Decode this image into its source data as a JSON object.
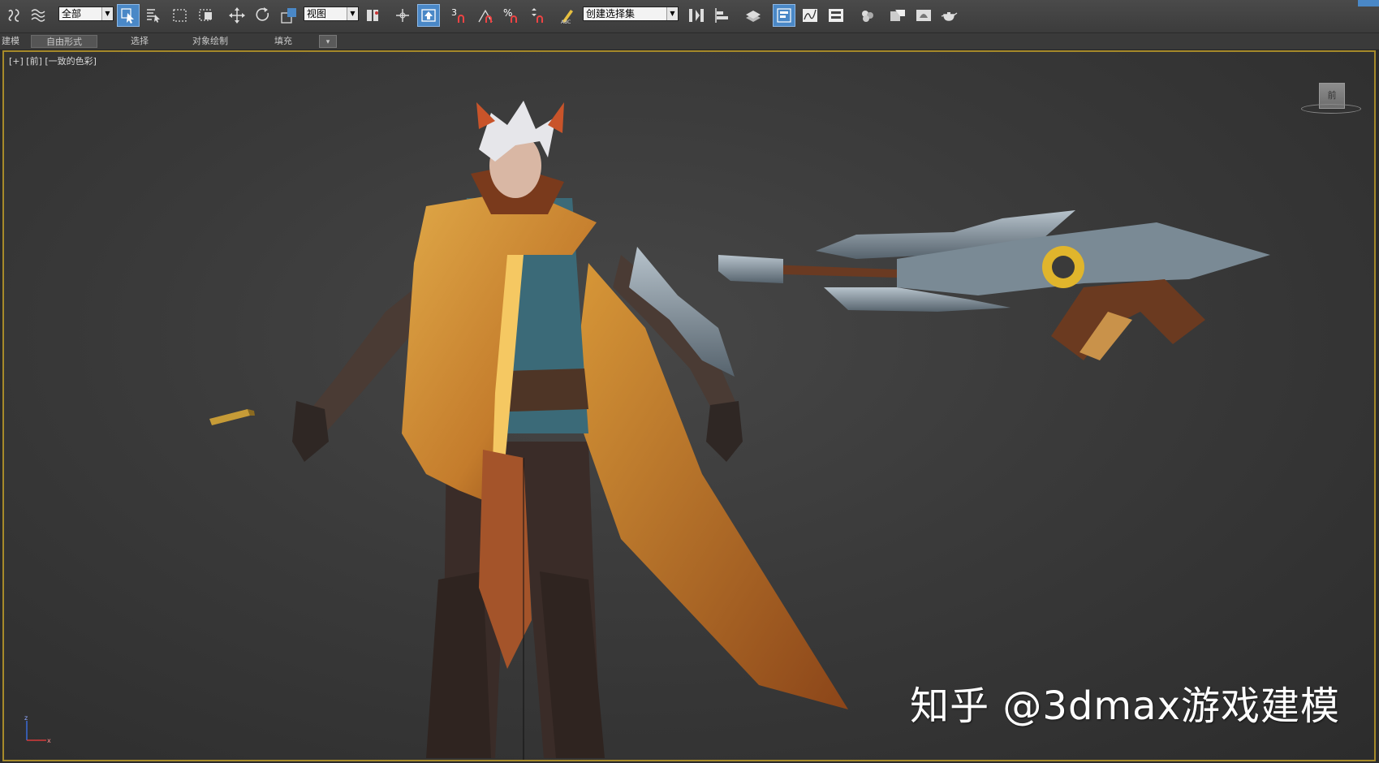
{
  "toolbar": {
    "selection_filter": "全部",
    "reference_coord": "视图",
    "named_selection": "创建选择集",
    "snap_angle_label": "3",
    "snap_percent_label": "%",
    "accent": "#4a88c7"
  },
  "ribbon": {
    "tabs": [
      {
        "label": "建模"
      },
      {
        "label": "自由形式"
      },
      {
        "label": "选择"
      },
      {
        "label": "对象绘制"
      },
      {
        "label": "填充"
      }
    ]
  },
  "viewport": {
    "label": "[+] [前] [一致的色彩]",
    "viewcube_face": "前",
    "axis": {
      "z": "z",
      "x": "x"
    },
    "border_color": "#a68a2a"
  },
  "watermark": "知乎 @3dmax游戏建模"
}
